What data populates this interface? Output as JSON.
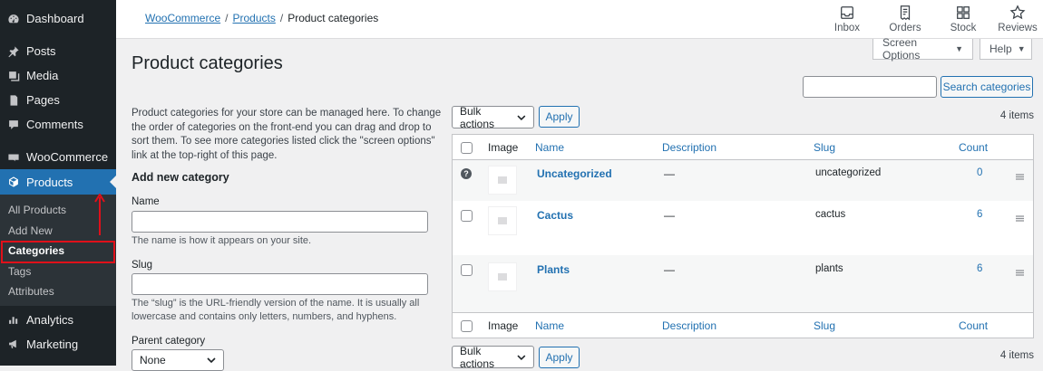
{
  "sidebar": {
    "items": [
      {
        "label": "Dashboard",
        "icon": "dashboard-icon"
      },
      {
        "label": "Posts",
        "icon": "pin-icon"
      },
      {
        "label": "Media",
        "icon": "media-icon"
      },
      {
        "label": "Pages",
        "icon": "pages-icon"
      },
      {
        "label": "Comments",
        "icon": "comment-icon"
      },
      {
        "label": "WooCommerce",
        "icon": "woo-icon"
      },
      {
        "label": "Products",
        "icon": "box-icon"
      },
      {
        "label": "Analytics",
        "icon": "analytics-icon"
      },
      {
        "label": "Marketing",
        "icon": "megaphone-icon"
      }
    ],
    "submenu": [
      "All Products",
      "Add New",
      "Categories",
      "Tags",
      "Attributes"
    ],
    "annotation_color": "#e0101a"
  },
  "topbar": {
    "breadcrumb": [
      "WooCommerce",
      "Products",
      "Product categories"
    ],
    "actions": [
      "Inbox",
      "Orders",
      "Stock",
      "Reviews"
    ],
    "screen_options": "Screen Options",
    "help": "Help"
  },
  "page": {
    "title": "Product categories",
    "description": "Product categories for your store can be managed here. To change the order of categories on the front-end you can drag and drop to sort them. To see more categories listed click the \"screen options\" link at the top-right of this page.",
    "form_heading": "Add new category",
    "name_label": "Name",
    "name_help": "The name is how it appears on your site.",
    "slug_label": "Slug",
    "slug_help": "The “slug” is the URL-friendly version of the name. It is usually all lowercase and contains only letters, numbers, and hyphens.",
    "parent_label": "Parent category",
    "parent_value": "None"
  },
  "list": {
    "search_button": "Search categories",
    "bulk_actions": "Bulk actions",
    "apply": "Apply",
    "items_count": "4 items",
    "columns": [
      "Image",
      "Name",
      "Description",
      "Slug",
      "Count"
    ],
    "rows": [
      {
        "name": "Uncategorized",
        "description": "—",
        "slug": "uncategorized",
        "count": "0"
      },
      {
        "name": "Cactus",
        "description": "—",
        "slug": "cactus",
        "count": "6"
      },
      {
        "name": "Plants",
        "description": "—",
        "slug": "plants",
        "count": "6"
      }
    ]
  }
}
